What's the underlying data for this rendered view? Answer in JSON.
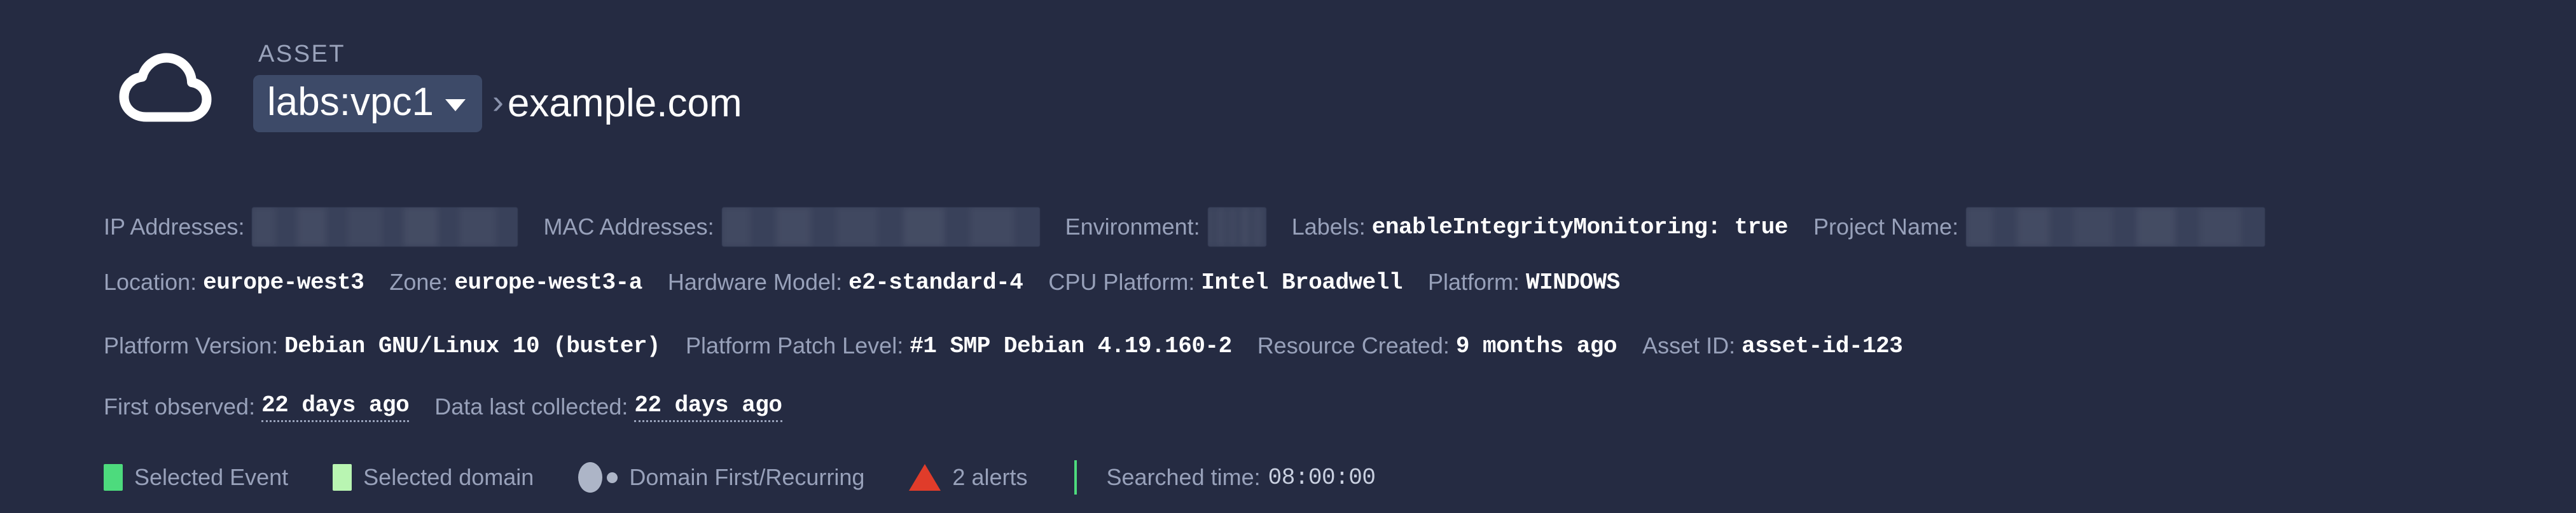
{
  "header": {
    "icon": "cloud-icon",
    "kicker": "ASSET",
    "scope": "labs:vpc1",
    "breadcrumb_separator": "›",
    "asset_name": "example.com"
  },
  "meta": {
    "row1": [
      {
        "label": "IP Addresses:",
        "value": "",
        "redacted": true,
        "name": "ip-addresses"
      },
      {
        "label": "MAC Addresses:",
        "value": "",
        "redacted": true,
        "name": "mac-addresses"
      },
      {
        "label": "Environment:",
        "value": "",
        "redacted": true,
        "name": "environment"
      },
      {
        "label": "Labels:",
        "value": "enableIntegrityMonitoring: true",
        "redacted": false,
        "name": "labels"
      },
      {
        "label": "Project Name:",
        "value": "",
        "redacted": true,
        "name": "project-name"
      }
    ],
    "row2": [
      {
        "label": "Location:",
        "value": "europe-west3",
        "name": "location"
      },
      {
        "label": "Zone:",
        "value": "europe-west3-a",
        "name": "zone"
      },
      {
        "label": "Hardware Model:",
        "value": "e2-standard-4",
        "name": "hardware-model"
      },
      {
        "label": "CPU Platform:",
        "value": "Intel Broadwell",
        "name": "cpu-platform"
      },
      {
        "label": "Platform:",
        "value": "WINDOWS",
        "name": "platform"
      }
    ],
    "row3": [
      {
        "label": "Platform Version:",
        "value": "Debian GNU/Linux 10 (buster)",
        "name": "platform-version"
      },
      {
        "label": "Platform Patch Level:",
        "value": "#1 SMP Debian 4.19.160-2",
        "name": "platform-patch-level"
      },
      {
        "label": "Resource Created:",
        "value": "9 months ago",
        "name": "resource-created"
      },
      {
        "label": "Asset ID:",
        "value": "asset-id-123",
        "name": "asset-id"
      }
    ],
    "row4": [
      {
        "label": "First observed:",
        "value": "22 days ago",
        "dotted": true,
        "name": "first-observed"
      },
      {
        "label": "Data last collected:",
        "value": "22 days ago",
        "dotted": true,
        "name": "data-last-collected"
      }
    ]
  },
  "legend": {
    "items": [
      {
        "label": "Selected Event",
        "marker": "square-swatch",
        "color": "#4ddb7d",
        "name": "legend-selected-event"
      },
      {
        "label": "Selected domain",
        "marker": "square-swatch",
        "color": "#b9f5b2",
        "name": "legend-selected-domain"
      },
      {
        "label": "Domain First/Recurring",
        "marker": "circle-pair",
        "color": "#adb5c7",
        "name": "legend-domain-first-recurring"
      },
      {
        "label": "2 alerts",
        "marker": "alert-triangle",
        "color": "#e03c2a",
        "name": "legend-alerts"
      }
    ],
    "divider_color": "#4ddb7d",
    "searched_time_label": "Searched time:",
    "searched_time_value": "08:00:00"
  },
  "colors": {
    "background": "#252b42",
    "pill_background": "#3d4a68",
    "label_text": "#98a1ba",
    "value_text": "#ffffff",
    "redaction": "#39415a",
    "accent_green": "#4ddb7d",
    "accent_light_green": "#b9f5b2",
    "alert_red": "#e03c2a"
  }
}
